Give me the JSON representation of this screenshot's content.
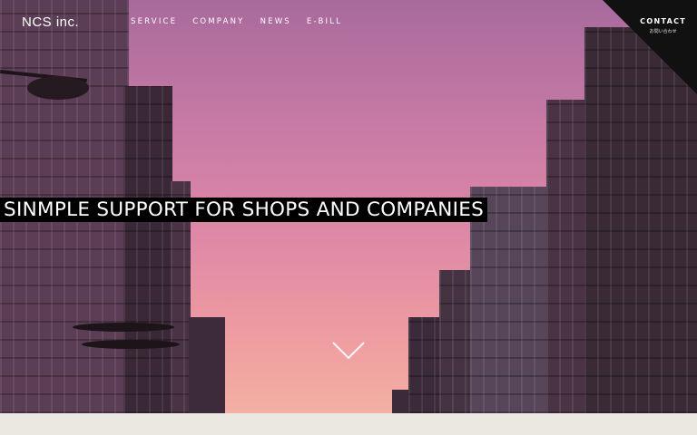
{
  "brand": {
    "logo": "NCS inc."
  },
  "nav": {
    "items": [
      {
        "label": "SERVICE"
      },
      {
        "label": "COMPANY"
      },
      {
        "label": "NEWS"
      },
      {
        "label": "E-BILL"
      }
    ]
  },
  "contact": {
    "label": "CONTACT",
    "sub": "お問い合わせ"
  },
  "hero": {
    "tagline": "SINMPLE SUPPORT FOR SHOPS AND COMPANIES",
    "scroll_icon": "chevron-down-icon"
  },
  "colors": {
    "sky_top": "#a86a9c",
    "sky_bottom": "#f3b0a3",
    "tagline_bg": "#000000",
    "contact_bg": "#111111",
    "footer_bg": "#ebe8e2"
  }
}
